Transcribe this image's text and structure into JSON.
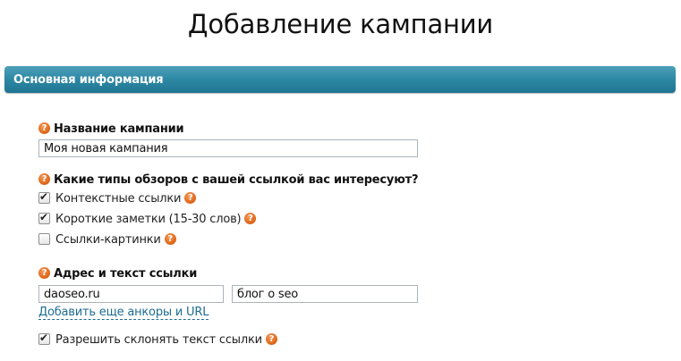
{
  "page": {
    "title": "Добавление кампании"
  },
  "section": {
    "header": "Основная информация"
  },
  "campaign_name": {
    "label": "Название кампании",
    "value": "Моя новая кампания"
  },
  "review_types": {
    "label": "Какие типы обзоров с вашей ссылкой вас интересуют?",
    "options": [
      {
        "label": "Контекстные ссылки",
        "checked": true
      },
      {
        "label": "Короткие заметки (15-30 слов)",
        "checked": true
      },
      {
        "label": "Ссылки-картинки",
        "checked": false
      }
    ]
  },
  "link": {
    "label": "Адрес и текст ссылки",
    "url_value": "daoseo.ru",
    "anchor_value": "блог о seo",
    "add_more_label": "Добавить еще анкоры и URL"
  },
  "inflect": {
    "label": "Разрешить склонять текст ссылки",
    "checked": true
  },
  "icons": {
    "help": "?",
    "check": "✔"
  },
  "colors": {
    "header_bg": "#2f8aa6",
    "help_icon": "#e06a1c",
    "link": "#1e6c92"
  }
}
